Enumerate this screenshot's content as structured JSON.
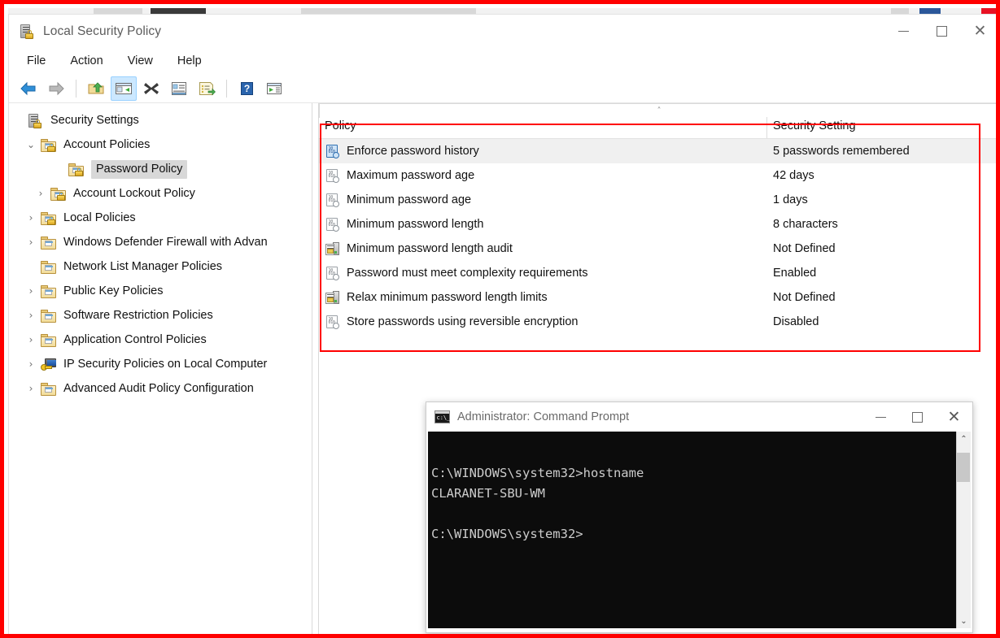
{
  "window": {
    "title": "Local Security Policy",
    "title_icon": "security-policy-icon",
    "controls": {
      "minimize": "minimize-icon",
      "maximize": "maximize-icon",
      "close": "close-icon",
      "close_glyph": "✕"
    }
  },
  "menubar": {
    "items": [
      {
        "label": "File"
      },
      {
        "label": "Action"
      },
      {
        "label": "View"
      },
      {
        "label": "Help"
      }
    ]
  },
  "toolbar": {
    "buttons": [
      {
        "name": "back-icon",
        "tooltip": "Back"
      },
      {
        "name": "forward-icon",
        "tooltip": "Forward"
      },
      {
        "name": "up-one-level-icon",
        "tooltip": "Up One Level"
      },
      {
        "name": "show-hide-console-tree-icon",
        "tooltip": "Show/Hide Console Tree",
        "active": true
      },
      {
        "name": "delete-icon",
        "tooltip": "Delete"
      },
      {
        "name": "properties-icon",
        "tooltip": "Properties"
      },
      {
        "name": "export-list-icon",
        "tooltip": "Export List"
      },
      {
        "name": "help-icon",
        "tooltip": "Help"
      },
      {
        "name": "show-hide-action-pane-icon",
        "tooltip": "Show/Hide Action Pane"
      }
    ]
  },
  "tree": {
    "items": [
      {
        "label": "Security Settings",
        "indent": 0,
        "expander": "",
        "icon": "security-settings-icon",
        "selected": false
      },
      {
        "label": "Account Policies",
        "indent": 1,
        "expander": "⌄",
        "icon": "folder-lock-icon",
        "selected": false
      },
      {
        "label": "Password Policy",
        "indent": 2,
        "expander": "",
        "icon": "folder-lock-icon",
        "selected": true
      },
      {
        "label": "Account Lockout Policy",
        "indent": 2,
        "expander": "›",
        "icon": "folder-lock-icon",
        "selected": false
      },
      {
        "label": "Local Policies",
        "indent": 1,
        "expander": "›",
        "icon": "folder-lock-icon",
        "selected": false
      },
      {
        "label": "Windows Defender Firewall with Advan",
        "indent": 1,
        "expander": "›",
        "icon": "folder-icon",
        "selected": false
      },
      {
        "label": "Network List Manager Policies",
        "indent": 1,
        "expander": "",
        "icon": "folder-icon",
        "selected": false
      },
      {
        "label": "Public Key Policies",
        "indent": 1,
        "expander": "›",
        "icon": "folder-icon",
        "selected": false
      },
      {
        "label": "Software Restriction Policies",
        "indent": 1,
        "expander": "›",
        "icon": "folder-icon",
        "selected": false
      },
      {
        "label": "Application Control Policies",
        "indent": 1,
        "expander": "›",
        "icon": "folder-icon",
        "selected": false
      },
      {
        "label": "IP Security Policies on Local Computer",
        "indent": 1,
        "expander": "›",
        "icon": "ip-security-icon",
        "selected": false
      },
      {
        "label": "Advanced Audit Policy Configuration",
        "indent": 1,
        "expander": "›",
        "icon": "folder-icon",
        "selected": false
      }
    ]
  },
  "list": {
    "sort_indicator": "˄",
    "columns": [
      {
        "label": "Policy"
      },
      {
        "label": "Security Setting"
      }
    ],
    "rows": [
      {
        "policy": "Enforce password history",
        "setting": "5 passwords remembered",
        "icon": "policy-setting-icon",
        "selected": true
      },
      {
        "policy": "Maximum password age",
        "setting": "42 days",
        "icon": "policy-setting-icon",
        "selected": false
      },
      {
        "policy": "Minimum password age",
        "setting": "1 days",
        "icon": "policy-setting-icon",
        "selected": false
      },
      {
        "policy": "Minimum password length",
        "setting": "8 characters",
        "icon": "policy-setting-icon",
        "selected": false
      },
      {
        "policy": "Minimum password length audit",
        "setting": "Not Defined",
        "icon": "machine-policy-icon",
        "selected": false
      },
      {
        "policy": "Password must meet complexity requirements",
        "setting": "Enabled",
        "icon": "policy-setting-icon",
        "selected": false
      },
      {
        "policy": "Relax minimum password length limits",
        "setting": "Not Defined",
        "icon": "machine-policy-icon",
        "selected": false
      },
      {
        "policy": "Store passwords using reversible encryption",
        "setting": "Disabled",
        "icon": "policy-setting-icon",
        "selected": false
      }
    ]
  },
  "annotation": {
    "color": "#ff0000",
    "outer_border_color": "#ff0000"
  },
  "cmd": {
    "title": "Administrator: Command Prompt",
    "title_icon": "command-prompt-icon",
    "controls": {
      "minimize": "—",
      "maximize": "□",
      "close": "✕"
    },
    "content": "\nC:\\WINDOWS\\system32>hostname\nCLARANET-SBU-WM\n\nC:\\WINDOWS\\system32>",
    "scrollbar": {
      "up_arrow": "⌃",
      "down_arrow": "⌄"
    }
  }
}
